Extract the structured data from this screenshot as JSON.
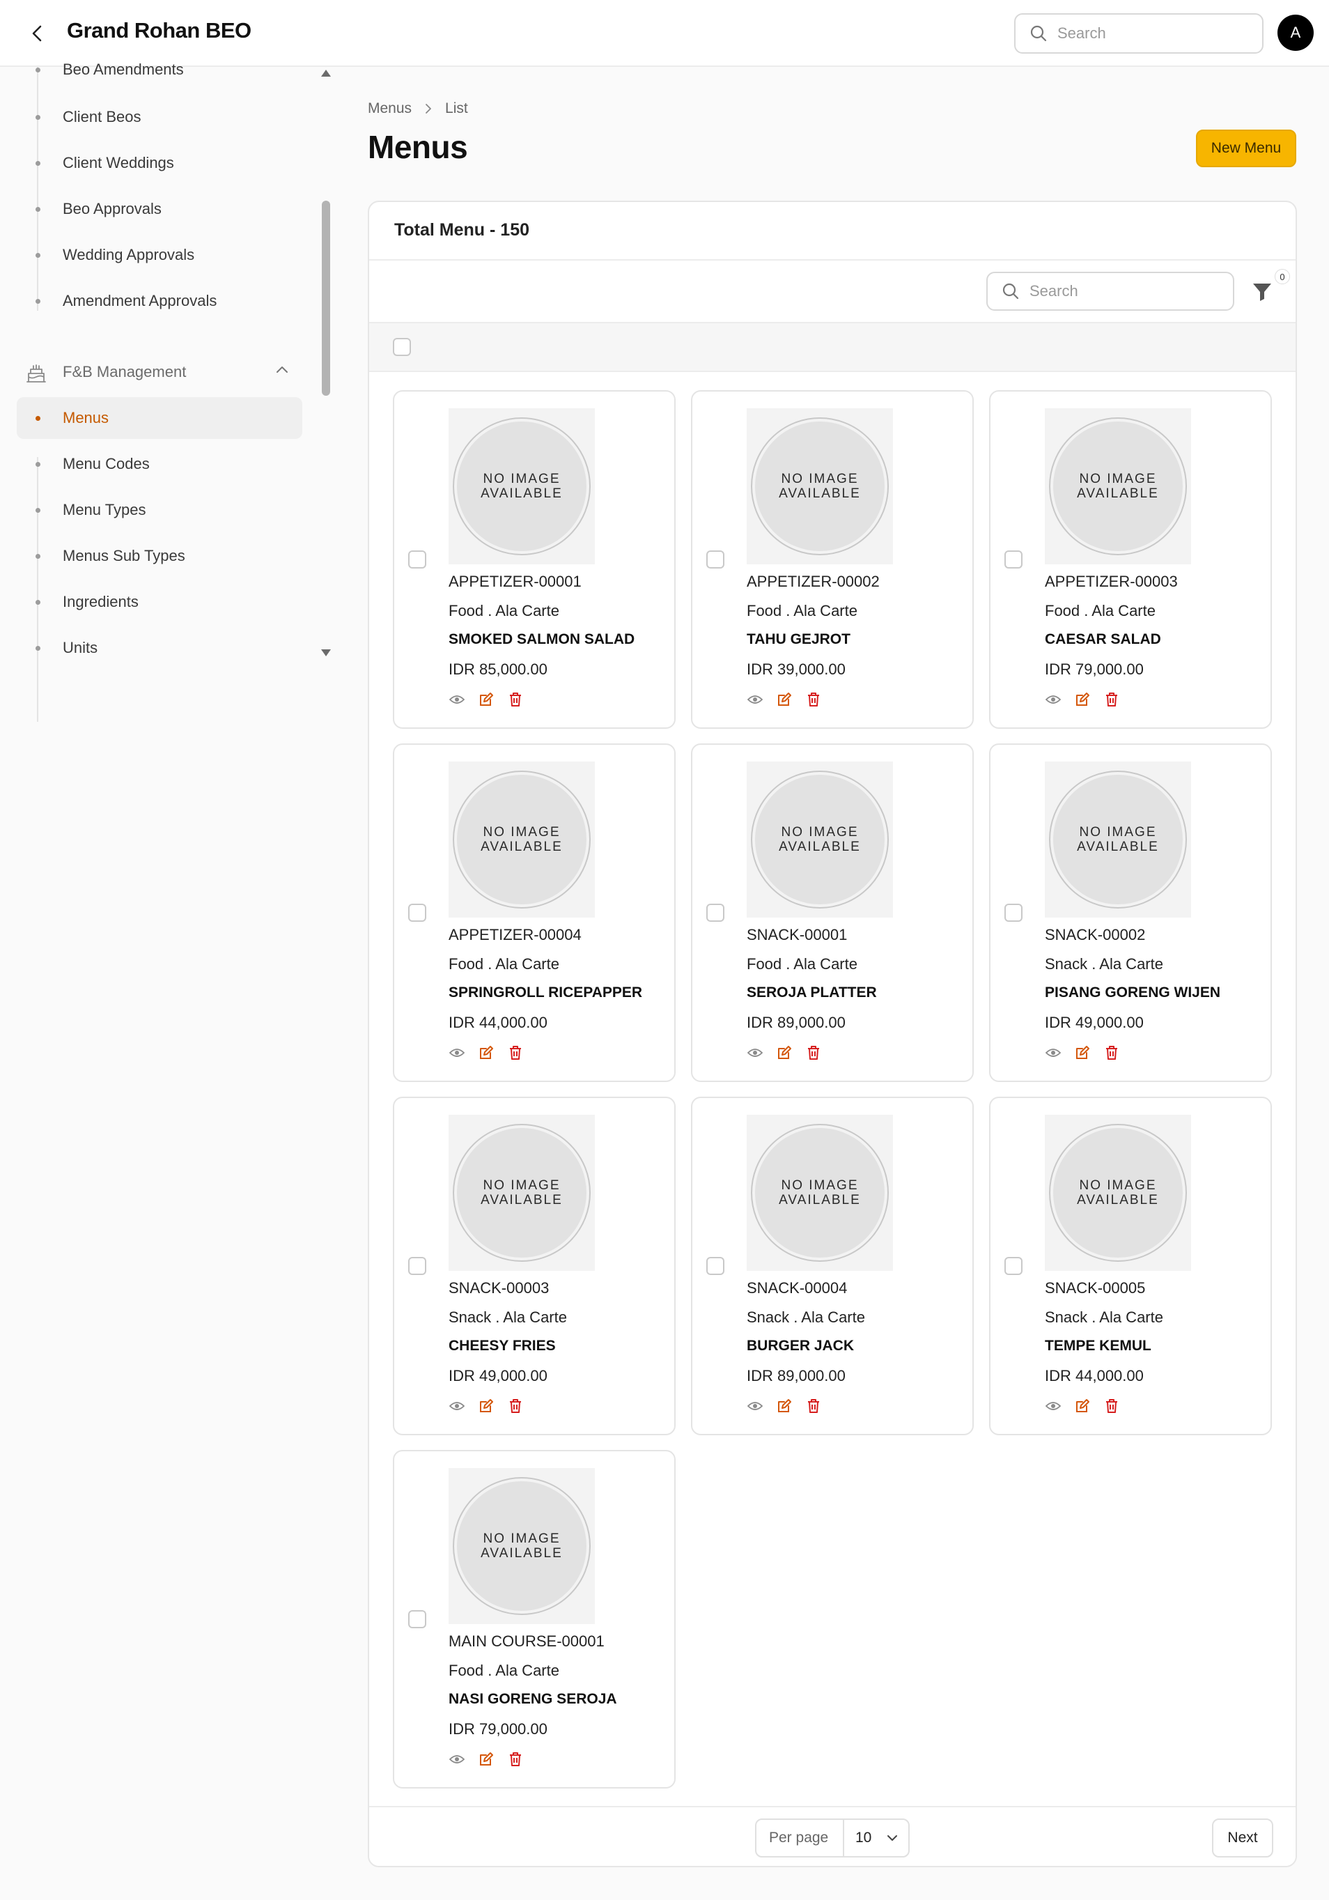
{
  "header": {
    "title": "Grand Rohan BEO",
    "search_placeholder": "Search",
    "avatar_initial": "A",
    "icons": [
      "back-icon",
      "search-icon"
    ]
  },
  "sidebar": {
    "items_top": [
      {
        "label": "Beo Amendments"
      },
      {
        "label": "Client Beos"
      },
      {
        "label": "Client Weddings"
      },
      {
        "label": "Beo Approvals"
      },
      {
        "label": "Wedding Approvals"
      },
      {
        "label": "Amendment Approvals"
      }
    ],
    "group": {
      "label": "F&B Management",
      "icon": "cake-icon",
      "expanded": true
    },
    "group_items": [
      {
        "label": "Menus",
        "active": true
      },
      {
        "label": "Menu Codes"
      },
      {
        "label": "Menu Types"
      },
      {
        "label": "Menus Sub Types"
      },
      {
        "label": "Ingredients"
      },
      {
        "label": "Units"
      }
    ]
  },
  "breadcrumb": [
    "Menus",
    "List"
  ],
  "page_title": "Menus",
  "new_button_label": "New Menu",
  "list": {
    "title": "Total Menu - 150",
    "search_placeholder": "Search",
    "filter_count": "0",
    "no_image_text": [
      "NO IMAGE",
      "AVAILABLE"
    ],
    "cards": [
      {
        "code": "APPETIZER-00001",
        "category": "Food . Ala Carte",
        "name": "SMOKED SALMON SALAD",
        "price": "IDR 85,000.00"
      },
      {
        "code": "APPETIZER-00002",
        "category": "Food . Ala Carte",
        "name": "TAHU GEJROT",
        "price": "IDR 39,000.00"
      },
      {
        "code": "APPETIZER-00003",
        "category": "Food . Ala Carte",
        "name": "CAESAR SALAD",
        "price": "IDR 79,000.00"
      },
      {
        "code": "APPETIZER-00004",
        "category": "Food . Ala Carte",
        "name": "SPRINGROLL RICEPAPPER",
        "price": "IDR 44,000.00"
      },
      {
        "code": "SNACK-00001",
        "category": "Food . Ala Carte",
        "name": "SEROJA PLATTER",
        "price": "IDR 89,000.00"
      },
      {
        "code": "SNACK-00002",
        "category": "Snack . Ala Carte",
        "name": "PISANG GORENG WIJEN",
        "price": "IDR 49,000.00"
      },
      {
        "code": "SNACK-00003",
        "category": "Snack . Ala Carte",
        "name": "CHEESY FRIES",
        "price": "IDR 49,000.00"
      },
      {
        "code": "SNACK-00004",
        "category": "Snack . Ala Carte",
        "name": "BURGER JACK",
        "price": "IDR 89,000.00"
      },
      {
        "code": "SNACK-00005",
        "category": "Snack . Ala Carte",
        "name": "TEMPE KEMUL",
        "price": "IDR 44,000.00"
      },
      {
        "code": "MAIN COURSE-00001",
        "category": "Food . Ala Carte",
        "name": "NASI GORENG SEROJA",
        "price": "IDR 79,000.00"
      }
    ],
    "card_actions": [
      "eye-icon",
      "edit-icon",
      "trash-icon"
    ]
  },
  "pagination": {
    "per_page_label": "Per page",
    "per_page_value": "10",
    "next_label": "Next"
  },
  "colors": {
    "accent": "#f7b500",
    "active_nav": "#c55a00",
    "edit_icon": "#d4570b",
    "delete_icon": "#d61f1f"
  }
}
